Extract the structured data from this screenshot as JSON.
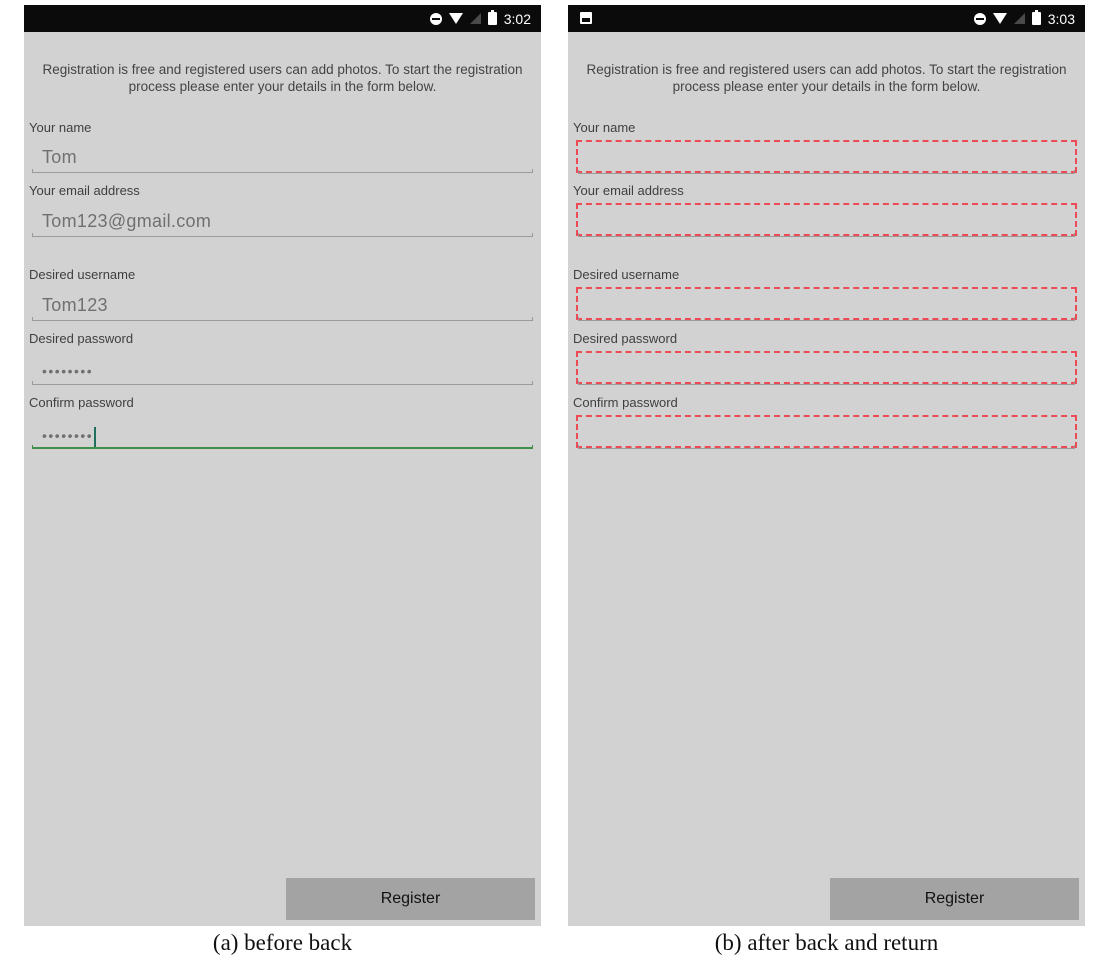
{
  "screens": [
    {
      "status_time": "3:02",
      "intro": "Registration is free and registered users can add photos. To start the registration process please enter your details in the form below.",
      "fields": [
        {
          "label": "Your name",
          "value": "Tom"
        },
        {
          "label": "Your email address",
          "value": "Tom123@gmail.com"
        },
        {
          "label": "Desired username",
          "value": "Tom123"
        },
        {
          "label": "Desired password",
          "value": "••••••••"
        },
        {
          "label": "Confirm password",
          "value": "••••••••"
        }
      ],
      "register_label": "Register",
      "caption": "(a)  before back"
    },
    {
      "status_time": "3:03",
      "intro": "Registration is free and registered users can add photos. To start the registration process please enter your details in the form below.",
      "fields": [
        {
          "label": "Your name",
          "value": ""
        },
        {
          "label": "Your email address",
          "value": ""
        },
        {
          "label": "Desired username",
          "value": ""
        },
        {
          "label": "Desired password",
          "value": ""
        },
        {
          "label": "Confirm password",
          "value": ""
        }
      ],
      "register_label": "Register",
      "caption": "(b)  after back and return"
    }
  ],
  "colors": {
    "screen_background": "#d2d2d2",
    "status_bar": "#0b0b0b",
    "focus_underline": "#3e8f47",
    "error_dashed_border": "#ec4b56",
    "register_button": "#a3a3a3"
  },
  "icons": [
    "do-not-disturb-icon",
    "wifi-icon",
    "signal-icon",
    "battery-icon",
    "photo-notification-icon"
  ]
}
